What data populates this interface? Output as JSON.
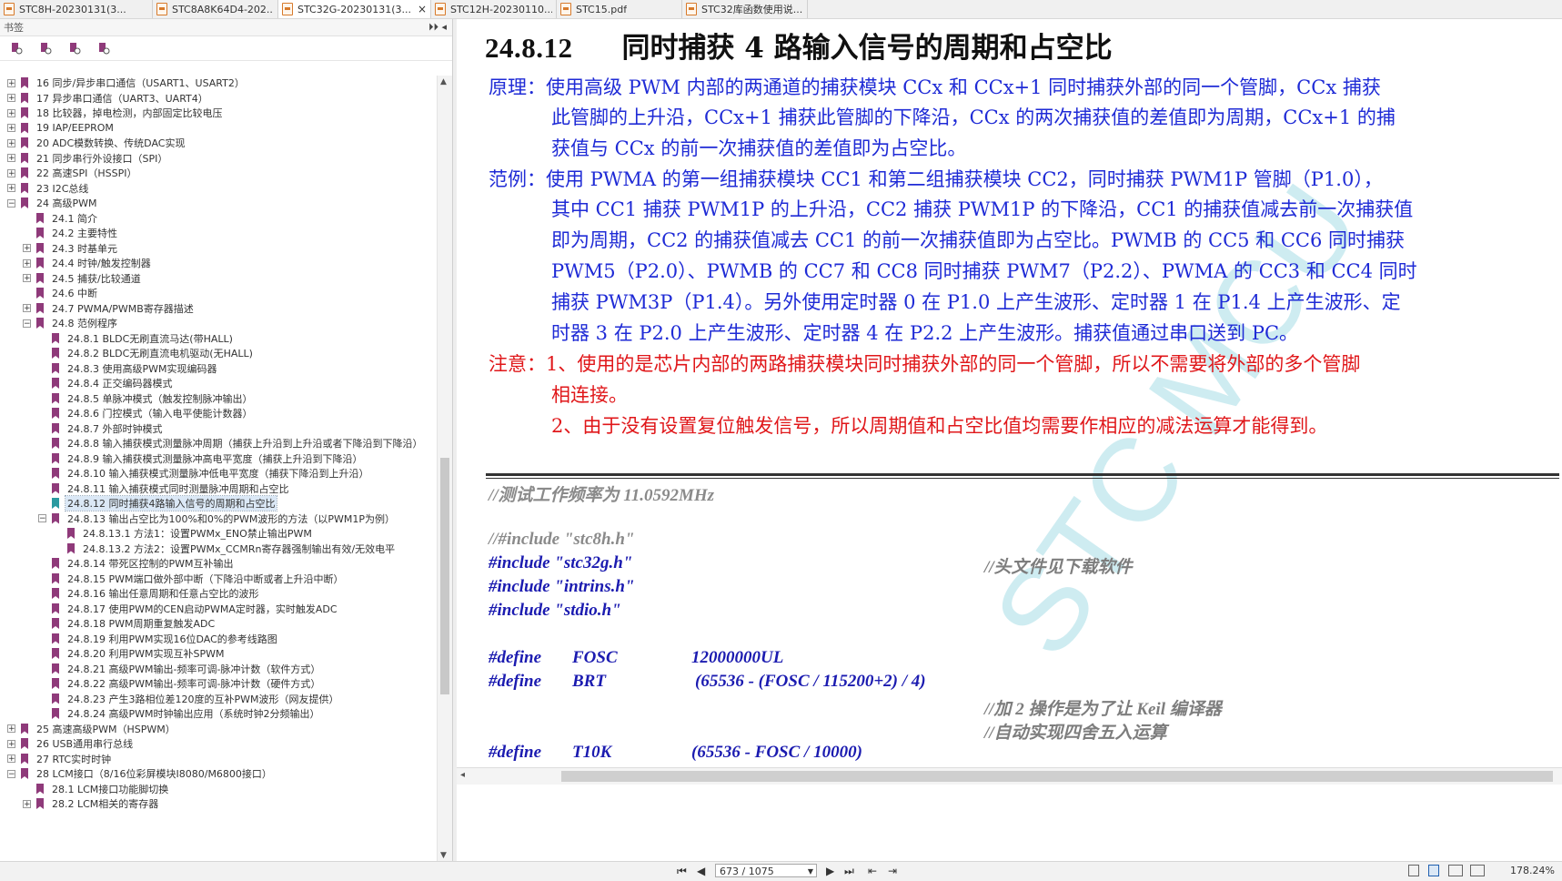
{
  "tabs": [
    {
      "label": "STC8H-20230131(3...",
      "active": false
    },
    {
      "label": "STC8A8K64D4-202...",
      "active": false
    },
    {
      "label": "STC32G-20230131(3...",
      "active": true,
      "close": "×"
    },
    {
      "label": "STC12H-20230110....",
      "active": false
    },
    {
      "label": "STC15.pdf",
      "active": false
    },
    {
      "label": "STC32库函数使用说...",
      "active": false
    }
  ],
  "sidebar": {
    "title": "书签",
    "controls": "⏵⏵ ◂",
    "tools": [
      "bookmark-expand-icon",
      "bookmark-collapse-icon",
      "bookmark-find-icon",
      "bookmark-expand-current-icon"
    ],
    "items": [
      {
        "level": 0,
        "toggle": "+",
        "label": "16 同步/异步串口通信（USART1、USART2）"
      },
      {
        "level": 0,
        "toggle": "+",
        "label": "17 异步串口通信（UART3、UART4）"
      },
      {
        "level": 0,
        "toggle": "+",
        "label": "18 比较器，掉电检测，内部固定比较电压"
      },
      {
        "level": 0,
        "toggle": "+",
        "label": "19 IAP/EEPROM"
      },
      {
        "level": 0,
        "toggle": "+",
        "label": "20 ADC模数转换、传统DAC实现"
      },
      {
        "level": 0,
        "toggle": "+",
        "label": "21 同步串行外设接口（SPI）"
      },
      {
        "level": 0,
        "toggle": "+",
        "label": "22 高速SPI（HSSPI）"
      },
      {
        "level": 0,
        "toggle": "+",
        "label": "23 I2C总线"
      },
      {
        "level": 0,
        "toggle": "−",
        "label": "24 高级PWM"
      },
      {
        "level": 1,
        "toggle": "",
        "label": "24.1 简介"
      },
      {
        "level": 1,
        "toggle": "",
        "label": "24.2 主要特性"
      },
      {
        "level": 1,
        "toggle": "+",
        "label": "24.3 时基单元"
      },
      {
        "level": 1,
        "toggle": "+",
        "label": "24.4 时钟/触发控制器"
      },
      {
        "level": 1,
        "toggle": "+",
        "label": "24.5 捕获/比较通道"
      },
      {
        "level": 1,
        "toggle": "",
        "label": "24.6 中断"
      },
      {
        "level": 1,
        "toggle": "+",
        "label": "24.7 PWMA/PWMB寄存器描述"
      },
      {
        "level": 1,
        "toggle": "−",
        "label": "24.8 范例程序"
      },
      {
        "level": 2,
        "toggle": "",
        "label": "24.8.1 BLDC无刷直流马达(带HALL)"
      },
      {
        "level": 2,
        "toggle": "",
        "label": "24.8.2 BLDC无刷直流电机驱动(无HALL)"
      },
      {
        "level": 2,
        "toggle": "",
        "label": "24.8.3 使用高级PWM实现编码器"
      },
      {
        "level": 2,
        "toggle": "",
        "label": "24.8.4 正交编码器模式"
      },
      {
        "level": 2,
        "toggle": "",
        "label": "24.8.5 单脉冲模式（触发控制脉冲输出）"
      },
      {
        "level": 2,
        "toggle": "",
        "label": "24.8.6 门控模式（输入电平使能计数器）"
      },
      {
        "level": 2,
        "toggle": "",
        "label": "24.8.7 外部时钟模式"
      },
      {
        "level": 2,
        "toggle": "",
        "label": "24.8.8 输入捕获模式测量脉冲周期（捕获上升沿到上升沿或者下降沿到下降沿）"
      },
      {
        "level": 2,
        "toggle": "",
        "label": "24.8.9 输入捕获模式测量脉冲高电平宽度（捕获上升沿到下降沿）"
      },
      {
        "level": 2,
        "toggle": "",
        "label": "24.8.10 输入捕获模式测量脉冲低电平宽度（捕获下降沿到上升沿）"
      },
      {
        "level": 2,
        "toggle": "",
        "label": "24.8.11 输入捕获模式同时测量脉冲周期和占空比"
      },
      {
        "level": 2,
        "toggle": "",
        "label": "24.8.12 同时捕获4路输入信号的周期和占空比",
        "selected": true
      },
      {
        "level": 2,
        "toggle": "−",
        "label": "24.8.13 输出占空比为100%和0%的PWM波形的方法（以PWM1P为例）"
      },
      {
        "level": 3,
        "toggle": "",
        "label": "24.8.13.1 方法1：设置PWMx_ENO禁止输出PWM"
      },
      {
        "level": 3,
        "toggle": "",
        "label": "24.8.13.2 方法2：设置PWMx_CCMRn寄存器强制输出有效/无效电平"
      },
      {
        "level": 2,
        "toggle": "",
        "label": "24.8.14 带死区控制的PWM互补输出"
      },
      {
        "level": 2,
        "toggle": "",
        "label": "24.8.15 PWM端口做外部中断（下降沿中断或者上升沿中断）"
      },
      {
        "level": 2,
        "toggle": "",
        "label": "24.8.16 输出任意周期和任意占空比的波形"
      },
      {
        "level": 2,
        "toggle": "",
        "label": "24.8.17 使用PWM的CEN启动PWMA定时器，实时触发ADC"
      },
      {
        "level": 2,
        "toggle": "",
        "label": "24.8.18 PWM周期重复触发ADC"
      },
      {
        "level": 2,
        "toggle": "",
        "label": "24.8.19 利用PWM实现16位DAC的参考线路图"
      },
      {
        "level": 2,
        "toggle": "",
        "label": "24.8.20 利用PWM实现互补SPWM"
      },
      {
        "level": 2,
        "toggle": "",
        "label": "24.8.21 高级PWM输出-频率可调-脉冲计数（软件方式）"
      },
      {
        "level": 2,
        "toggle": "",
        "label": "24.8.22 高级PWM输出-频率可调-脉冲计数（硬件方式）"
      },
      {
        "level": 2,
        "toggle": "",
        "label": "24.8.23 产生3路相位差120度的互补PWM波形（网友提供）"
      },
      {
        "level": 2,
        "toggle": "",
        "label": "24.8.24 高级PWM时钟输出应用（系统时钟2分频输出）"
      },
      {
        "level": 0,
        "toggle": "+",
        "label": "25 高速高级PWM（HSPWM）"
      },
      {
        "level": 0,
        "toggle": "+",
        "label": "26 USB通用串行总线"
      },
      {
        "level": 0,
        "toggle": "+",
        "label": "27 RTC实时时钟"
      },
      {
        "level": 0,
        "toggle": "−",
        "label": "28 LCM接口（8/16位彩屏模块I8080/M6800接口）"
      },
      {
        "level": 1,
        "toggle": "",
        "label": "28.1 LCM接口功能脚切换"
      },
      {
        "level": 1,
        "toggle": "+",
        "label": "28.2 LCM相关的寄存器"
      }
    ]
  },
  "doc": {
    "heading_num": "24.8.12",
    "heading_text": "同时捕获 4 路输入信号的周期和占空比",
    "principle": [
      "原理：使用高级 PWM 内部的两通道的捕获模块 CCx 和 CCx+1 同时捕获外部的同一个管脚，CCx 捕获",
      "此管脚的上升沿，CCx+1 捕获此管脚的下降沿，CCx 的两次捕获值的差值即为周期，CCx+1 的捕",
      "获值与 CCx 的前一次捕获值的差值即为占空比。"
    ],
    "example": [
      "范例：使用 PWMA 的第一组捕获模块 CC1 和第二组捕获模块 CC2，同时捕获 PWM1P 管脚（P1.0），",
      "其中 CC1 捕获 PWM1P 的上升沿，CC2 捕获 PWM1P 的下降沿，CC1 的捕获值减去前一次捕获值",
      "即为周期，CC2 的捕获值减去 CC1 的前一次捕获值即为占空比。PWMB 的 CC5 和 CC6 同时捕获",
      "PWM5（P2.0）、PWMB 的 CC7 和 CC8 同时捕获 PWM7（P2.2）、PWMA 的 CC3 和 CC4 同时",
      "捕获 PWM3P（P1.4）。另外使用定时器 0 在 P1.0 上产生波形、定时器 1 在 P1.4 上产生波形、定",
      "时器 3 在 P2.0 上产生波形、定时器 4 在 P2.2 上产生波形。捕获值通过串口送到 PC。"
    ],
    "notes": [
      "注意：1、使用的是芯片内部的两路捕获模块同时捕获外部的同一个管脚，所以不需要将外部的多个管脚",
      "相连接。",
      "2、由于没有设置复位触发信号，所以周期值和占空比值均需要作相应的减法运算才能得到。"
    ],
    "code": {
      "test_freq": "//测试工作频率为 11.0592MHz",
      "inc_comment": "//#include \"stc8h.h\"",
      "inc1": "#include \"stc32g.h\"",
      "inc1_comment": "//头文件见下载软件",
      "inc2": "#include \"intrins.h\"",
      "inc3": "#include \"stdio.h\"",
      "define_kw": "#define",
      "fosc_name": "FOSC",
      "fosc_val": "12000000UL",
      "brt_name": "BRT",
      "brt_val": "(65536 - (FOSC / 115200+2) / 4)",
      "brt_comment1": "//加 2 操作是为了让 Keil 编译器",
      "brt_comment2": "//自动实现四舍五入运算",
      "t10k_name": "T10K",
      "t10k_val": "(65536 - FOSC / 10000)"
    },
    "watermark": "STC MCU"
  },
  "status": {
    "first": "⏮",
    "prev": "◀",
    "next": "▶",
    "last": "⏭",
    "page": "673 / 1075",
    "zoom": "178.24%"
  },
  "colors": {
    "accent_blue": "#1f2bd6",
    "note_red": "#e0171a",
    "bookmark": "#8f3a7a",
    "bookmark_current": "#2a9aa0"
  }
}
